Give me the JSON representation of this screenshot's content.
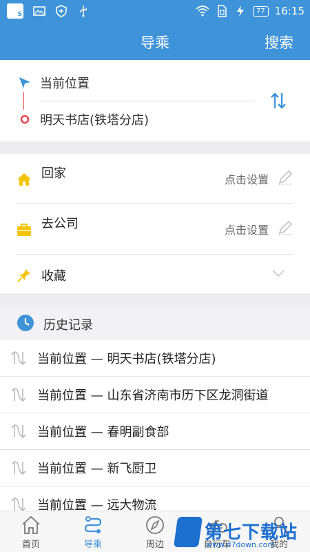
{
  "status_bar": {
    "time": "16:15",
    "battery": "77"
  },
  "header": {
    "title": "导乘",
    "search_label": "搜索"
  },
  "route": {
    "origin": "当前位置",
    "destination": "明天书店(铁塔分店)"
  },
  "quick": {
    "home": {
      "label": "回家",
      "action": "点击设置"
    },
    "work": {
      "label": "去公司",
      "action": "点击设置"
    },
    "favorites": {
      "label": "收藏"
    }
  },
  "history": {
    "title": "历史记录",
    "items": [
      "当前位置 — 明天书店(铁塔分店)",
      "当前位置 — 山东省济南市历下区龙洞街道",
      "当前位置 — 春明副食部",
      "当前位置 — 新飞厨卫",
      "当前位置 — 远大物流"
    ]
  },
  "tabs": [
    "首页",
    "导乘",
    "周边",
    "自行车",
    "我的"
  ],
  "watermark": {
    "title": "第七下载站",
    "url": "www.d7down.com"
  },
  "colors": {
    "primary": "#3f93d9",
    "home_icon": "#f5c400",
    "destination_ring": "#e6454f"
  }
}
